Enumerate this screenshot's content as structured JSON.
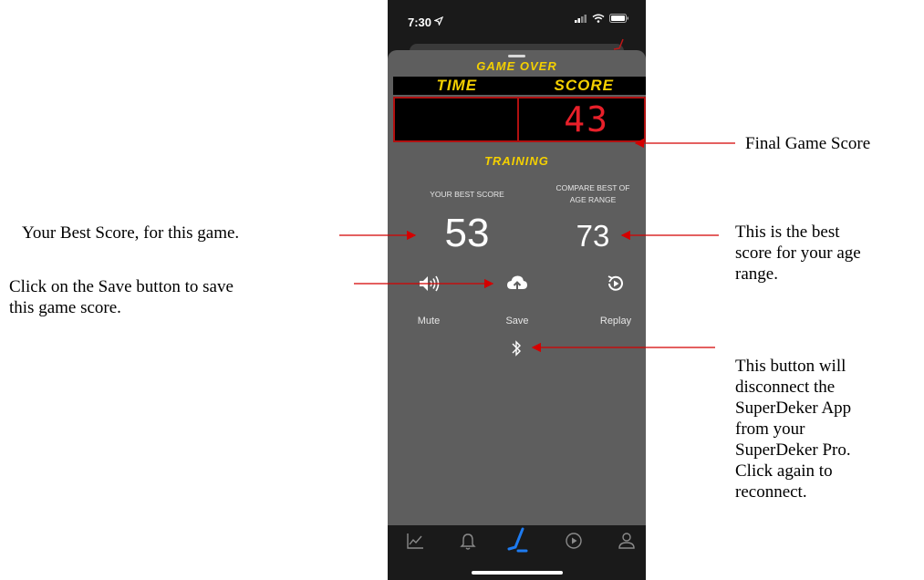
{
  "status_bar": {
    "time": "7:30",
    "location_icon": "location-arrow-icon",
    "signal_icon": "signal-bars-icon",
    "wifi_icon": "wifi-icon",
    "battery_icon": "battery-icon"
  },
  "game_over": {
    "title": "GAME OVER",
    "time_header": "TIME",
    "score_header": "SCORE",
    "time_value": "",
    "score_value": "43"
  },
  "training_label": "TRAINING",
  "best": {
    "label": "YOUR BEST SCORE",
    "value": "53"
  },
  "compare": {
    "label_line1": "COMPARE BEST OF",
    "label_line2": "AGE RANGE",
    "value": "73"
  },
  "controls": [
    {
      "label": "Mute",
      "icon": "speaker-icon"
    },
    {
      "label": "Save",
      "icon": "cloud-upload-icon"
    },
    {
      "label": "Replay",
      "icon": "replay-icon"
    }
  ],
  "bluetooth_icon": "bluetooth-icon",
  "tabbar": [
    {
      "icon": "chart-icon"
    },
    {
      "icon": "bell-icon"
    },
    {
      "icon": "hockey-stick-icon",
      "active": true
    },
    {
      "icon": "play-icon"
    },
    {
      "icon": "user-icon"
    }
  ],
  "annotations": {
    "final_score": "Final Game Score",
    "best_score": "Your Best Score, for this game.",
    "save_line1": "Click on the Save button to save",
    "save_line2": "this game score.",
    "age_line1": "This is the best",
    "age_line2": "score for your age",
    "age_line3": "range.",
    "bt_line1": "This button will",
    "bt_line2": "disconnect the",
    "bt_line3": "SuperDeker App",
    "bt_line4": "from your",
    "bt_line5": "SuperDeker Pro.",
    "bt_line6": "Click again to",
    "bt_line7": "reconnect."
  },
  "colors": {
    "accent_yellow": "#f4d000",
    "score_red": "#e8202a",
    "arrow_red": "#d40000",
    "active_tab_blue": "#1e7bf0",
    "sheet_gray": "#5e5e5e"
  }
}
